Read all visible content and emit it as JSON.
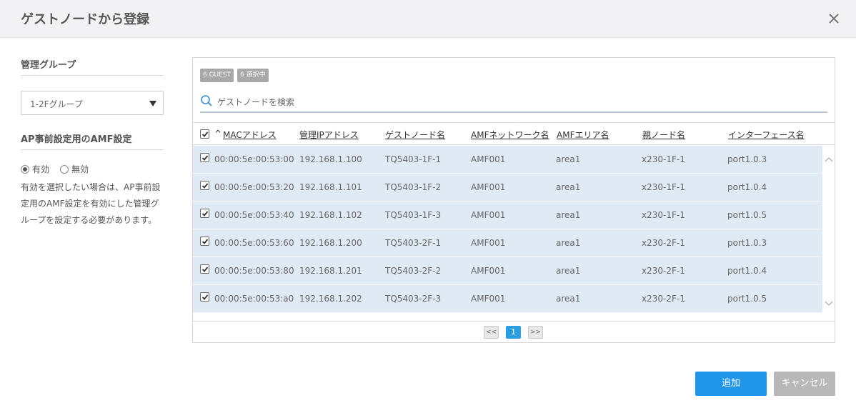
{
  "dialog": {
    "title": "ゲストノードから登録"
  },
  "left": {
    "group_title": "管理グループ",
    "group_select": "1-2Fグループ",
    "amf_title": "AP事前設定用のAMF設定",
    "radio_on": "有効",
    "radio_off": "無効",
    "note": "有効を選択したい場合は、AP事前設定用のAMF設定を有効にした管理グループを設定する必要があります。"
  },
  "table": {
    "badge_guest": "6 GUEST",
    "badge_selected": "6 選択中",
    "search_placeholder": "ゲストノードを検索",
    "sort_indicator": "^",
    "headers": [
      "MACアドレス",
      "管理IPアドレス",
      "ゲストノード名",
      "AMFネットワーク名",
      "AMFエリア名",
      "親ノード名",
      "インターフェース名"
    ],
    "rows": [
      [
        "00:00:5e:00:53:00",
        "192.168.1.100",
        "TQ5403-1F-1",
        "AMF001",
        "area1",
        "x230-1F-1",
        "port1.0.3"
      ],
      [
        "00:00:5e:00:53:20",
        "192.168.1.101",
        "TQ5403-1F-2",
        "AMF001",
        "area1",
        "x230-1F-1",
        "port1.0.4"
      ],
      [
        "00:00:5e:00:53:40",
        "192.168.1.102",
        "TQ5403-1F-3",
        "AMF001",
        "area1",
        "x230-1F-1",
        "port1.0.5"
      ],
      [
        "00:00:5e:00:53:60",
        "192.168.1.200",
        "TQ5403-2F-1",
        "AMF001",
        "area1",
        "x230-2F-1",
        "port1.0.3"
      ],
      [
        "00:00:5e:00:53:80",
        "192.168.1.201",
        "TQ5403-2F-2",
        "AMF001",
        "area1",
        "x230-2F-1",
        "port1.0.4"
      ],
      [
        "00:00:5e:00:53:a0",
        "192.168.1.202",
        "TQ5403-2F-3",
        "AMF001",
        "area1",
        "x230-2F-1",
        "port1.0.5"
      ]
    ]
  },
  "pager": {
    "first": "<<",
    "current": "1",
    "next": ">>"
  },
  "footer": {
    "add": "追加",
    "cancel": "キャンセル"
  }
}
